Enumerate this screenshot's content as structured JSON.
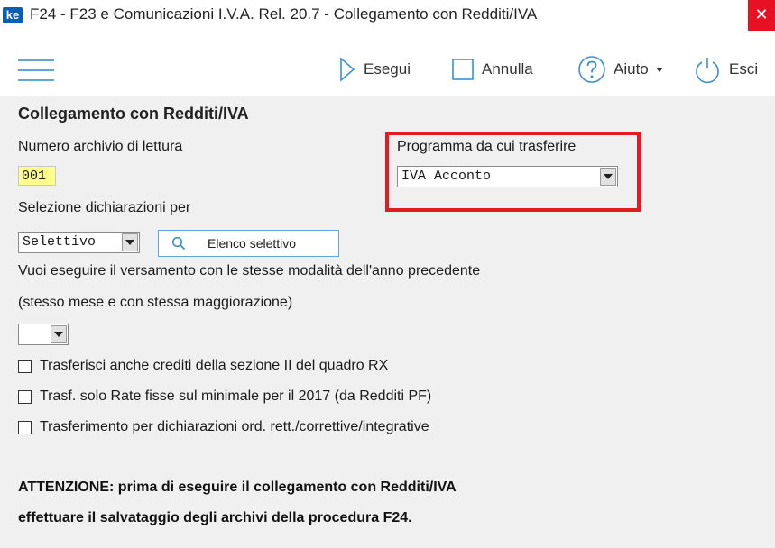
{
  "window": {
    "logo_text": "ke",
    "title": "F24 - F23 e Comunicazioni I.V.A. Rel. 20.7 - Collegamento con Redditi/IVA",
    "close_glyph": "✕"
  },
  "toolbar": {
    "menu_icon": "hamburger-icon",
    "run_label": "Esegui",
    "cancel_label": "Annulla",
    "help_label": "Aiuto",
    "exit_label": "Esci"
  },
  "form": {
    "section_title": "Collegamento con Redditi/IVA",
    "archive_label": "Numero archivio di lettura",
    "archive_value": "001",
    "program_label": "Programma da cui trasferire",
    "program_value": "IVA Acconto",
    "selection_label": "Selezione dichiarazioni per",
    "selection_value": "Selettivo",
    "selective_list_label": "Elenco selettivo",
    "same_mode_question_line1": "Vuoi eseguire il versamento con le stesse modalità dell'anno precedente",
    "same_mode_question_line2": "(stesso mese e con stessa maggiorazione)",
    "same_mode_value": "",
    "checkboxes": [
      {
        "label": "Trasferisci anche crediti della sezione II del quadro RX",
        "checked": false
      },
      {
        "label": "Trasf. solo Rate fisse sul minimale per il 2017 (da Redditi PF)",
        "checked": false
      },
      {
        "label": "Trasferimento per dichiarazioni ord. rett./correttive/integrative",
        "checked": false
      }
    ],
    "warning_line1": "ATTENZIONE: prima di eseguire il collegamento con Redditi/IVA",
    "warning_line2": "effettuare il salvataggio degli archivi della procedura F24."
  },
  "colors": {
    "accent": "#5fa6dd",
    "highlight": "#e31b23",
    "input_yellow": "#ffff8a",
    "close_red": "#e81123"
  }
}
